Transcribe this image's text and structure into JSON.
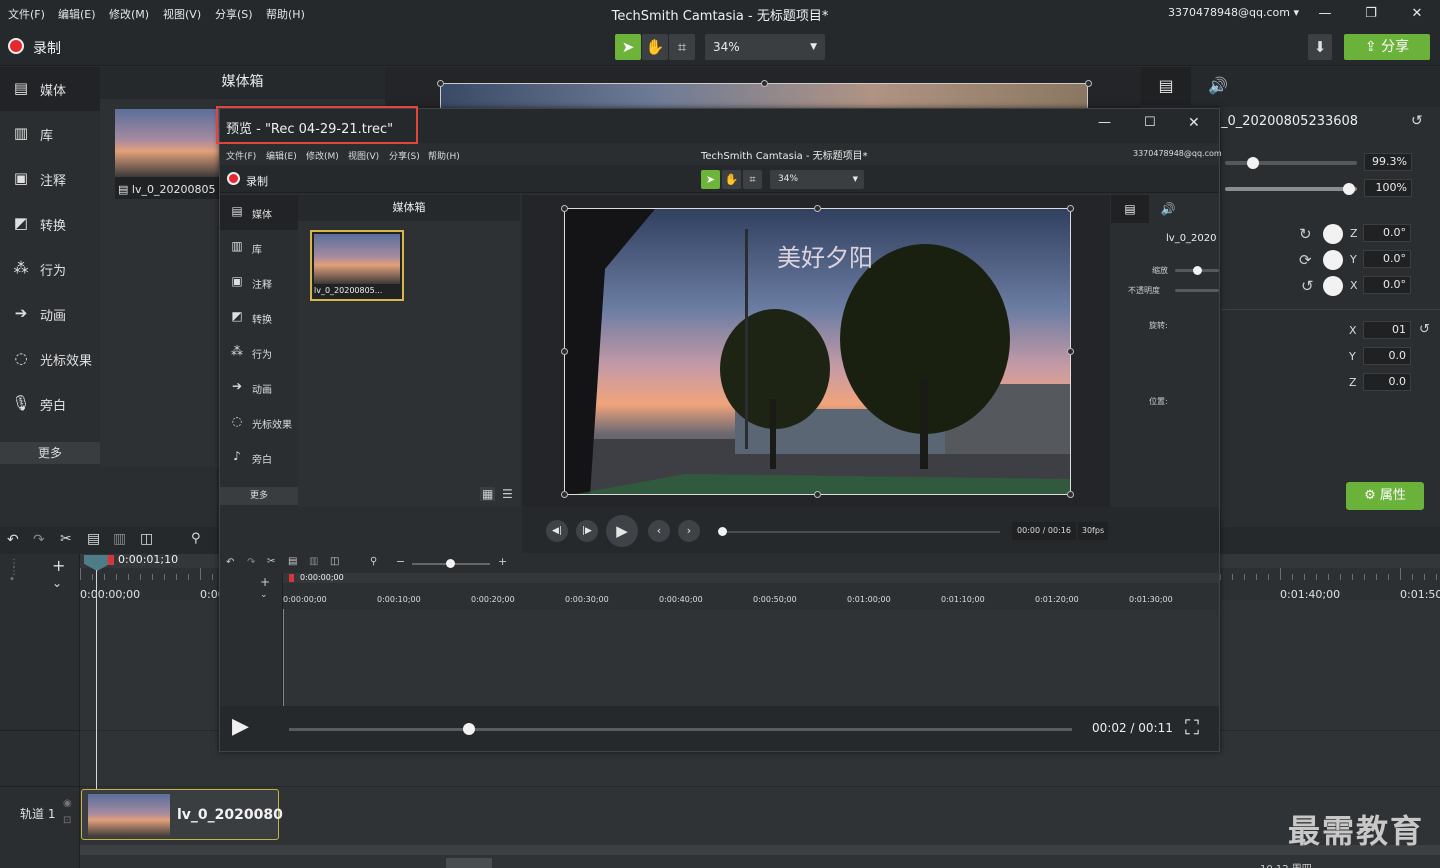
{
  "menu": [
    "文件(F)",
    "编辑(E)",
    "修改(M)",
    "视图(V)",
    "分享(S)",
    "帮助(H)"
  ],
  "window_title": "TechSmith Camtasia - 无标题项目*",
  "account": "3370478948@qq.com",
  "record_label": "录制",
  "zoom": "34%",
  "share_label": "分享",
  "nav": [
    "媒体",
    "库",
    "注释",
    "转换",
    "行为",
    "动画",
    "光标效果",
    "旁白"
  ],
  "more_label": "更多",
  "media_bin_title": "媒体箱",
  "clip_name": "lv_0_20200805",
  "clip_full_name": "_0_20200805233608",
  "props": {
    "scale": "99.3%",
    "opacity": "100%",
    "rot_z": "0.0°",
    "rot_y": "0.0°",
    "rot_x": "0.0°",
    "pos_x": "01",
    "pos_y": "0.0",
    "pos_z": "0.0",
    "z_label": "Z",
    "y_label": "Y",
    "x_label": "X",
    "attr_button": "属性"
  },
  "timeline": {
    "playhead_time": "0:00:01;10",
    "ruler_start": "0:00:00;00",
    "ruler_partial": "0:00",
    "ruler_right1": "0:01:40;00",
    "ruler_right2": "0:01:50;",
    "track_label": "轨道 1",
    "clip_label": "lv_0_2020080"
  },
  "preview": {
    "title": "预览 - \"Rec 04-29-21.trec\"",
    "inner_title": "TechSmith Camtasia - 无标题项目*",
    "inner_menu": [
      "文件(F)",
      "编辑(E)",
      "修改(M)",
      "视图(V)",
      "分享(S)",
      "帮助(H)"
    ],
    "inner_account": "3370478948@qq.com",
    "inner_record": "录制",
    "inner_zoom": "34%",
    "inner_nav": [
      "媒体",
      "库",
      "注释",
      "转换",
      "行为",
      "动画",
      "光标效果",
      "旁白"
    ],
    "inner_more": "更多",
    "inner_bin_title": "媒体箱",
    "inner_clip_name": "lv_0_20200805...",
    "video_caption": "美好夕阳",
    "inner_props_name": "lv_0_2020",
    "inner_scale_label": "缩放",
    "inner_opacity_label": "不透明度",
    "inner_rotation_label": "旋转:",
    "inner_position_label": "位置:",
    "inner_time": "00:00 / 00:16",
    "inner_fps": "30fps",
    "inner_playhead": "0:00:00;00",
    "inner_ruler": [
      "0:00:00;00",
      "0:00:10;00",
      "0:00:20;00",
      "0:00:30;00",
      "0:00:40;00",
      "0:00:50;00",
      "0:01:00;00",
      "0:01:10;00",
      "0:01:20;00",
      "0:01:30;00"
    ],
    "playback_time": "00:02 / 00:11",
    "playback_progress": 0.23
  },
  "watermark": "最需教育",
  "bottom_partial": "10.12 周四"
}
